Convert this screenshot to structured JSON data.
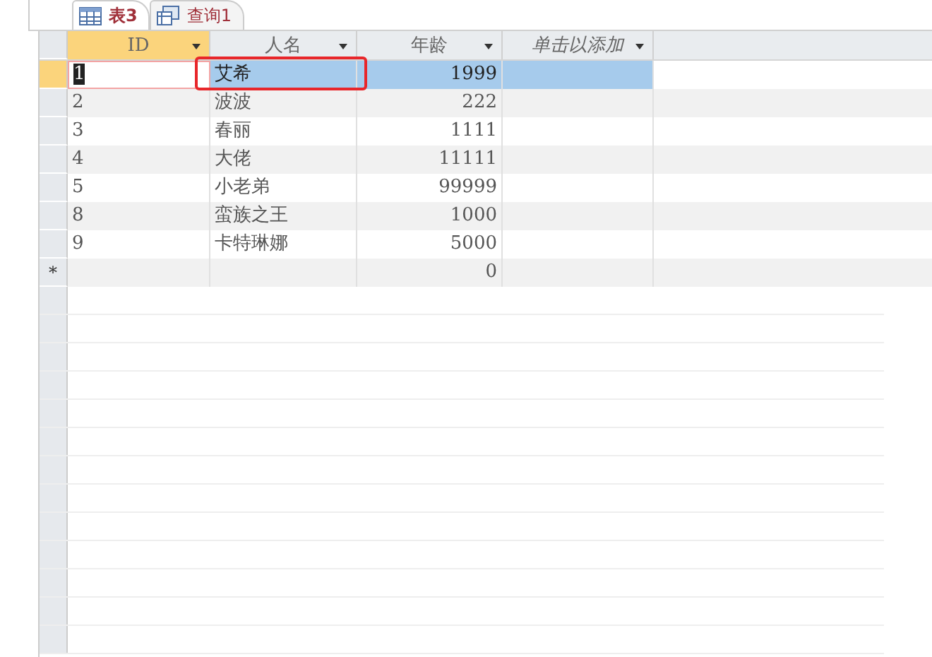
{
  "tabs": [
    {
      "label": "表3",
      "kind": "table",
      "selected": true
    },
    {
      "label": "查询1",
      "kind": "query",
      "selected": false
    }
  ],
  "columns": [
    {
      "label": "ID",
      "kind": "field"
    },
    {
      "label": "人名",
      "kind": "field"
    },
    {
      "label": "年龄",
      "kind": "field"
    },
    {
      "label": "单击以添加",
      "kind": "add"
    }
  ],
  "rows": [
    {
      "cells": [
        "1",
        "艾希",
        "1999"
      ],
      "selected": true
    },
    {
      "cells": [
        "2",
        "波波",
        "222"
      ],
      "selected": false
    },
    {
      "cells": [
        "3",
        "春丽",
        "1111"
      ],
      "selected": false
    },
    {
      "cells": [
        "4",
        "大佬",
        "11111"
      ],
      "selected": false
    },
    {
      "cells": [
        "5",
        "小老弟",
        "99999"
      ],
      "selected": false
    },
    {
      "cells": [
        "8",
        "蛮族之王",
        "1000"
      ],
      "selected": false
    },
    {
      "cells": [
        "9",
        "卡特琳娜",
        "5000"
      ],
      "selected": false
    }
  ],
  "new_row": {
    "marker": "*",
    "cells": [
      "",
      "",
      "0"
    ]
  }
}
